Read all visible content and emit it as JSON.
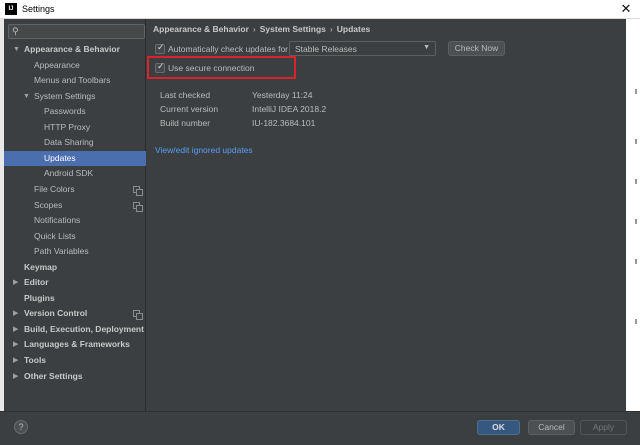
{
  "window": {
    "title": "Settings",
    "app_icon": "IJ"
  },
  "search": {
    "placeholder": ""
  },
  "tree": [
    {
      "label": "Appearance & Behavior",
      "level": 0,
      "bold": true,
      "arrow": "▼"
    },
    {
      "label": "Appearance",
      "level": 1
    },
    {
      "label": "Menus and Toolbars",
      "level": 1
    },
    {
      "label": "System Settings",
      "level": 1,
      "arrow": "▼"
    },
    {
      "label": "Passwords",
      "level": 2
    },
    {
      "label": "HTTP Proxy",
      "level": 2
    },
    {
      "label": "Data Sharing",
      "level": 2
    },
    {
      "label": "Updates",
      "level": 2,
      "selected": true
    },
    {
      "label": "Android SDK",
      "level": 2
    },
    {
      "label": "File Colors",
      "level": 1,
      "copy": true
    },
    {
      "label": "Scopes",
      "level": 1,
      "copy": true
    },
    {
      "label": "Notifications",
      "level": 1
    },
    {
      "label": "Quick Lists",
      "level": 1
    },
    {
      "label": "Path Variables",
      "level": 1
    },
    {
      "label": "Keymap",
      "level": 0,
      "bold": true
    },
    {
      "label": "Editor",
      "level": 0,
      "bold": true,
      "arrow": "▶"
    },
    {
      "label": "Plugins",
      "level": 0,
      "bold": true
    },
    {
      "label": "Version Control",
      "level": 0,
      "bold": true,
      "arrow": "▶",
      "copy": true
    },
    {
      "label": "Build, Execution, Deployment",
      "level": 0,
      "bold": true,
      "arrow": "▶"
    },
    {
      "label": "Languages & Frameworks",
      "level": 0,
      "bold": true,
      "arrow": "▶"
    },
    {
      "label": "Tools",
      "level": 0,
      "bold": true,
      "arrow": "▶"
    },
    {
      "label": "Other Settings",
      "level": 0,
      "bold": true,
      "arrow": "▶"
    }
  ],
  "breadcrumb": {
    "part1": "Appearance & Behavior",
    "sep": "›",
    "part2": "System Settings",
    "part3": "Updates"
  },
  "updates": {
    "auto_check_label": "Automatically check updates for",
    "auto_check_checked": true,
    "channel": "Stable Releases",
    "check_now_label": "Check Now",
    "secure_label": "Use secure connection",
    "secure_checked": true,
    "last_checked_label": "Last checked",
    "last_checked_value": "Yesterday 11:24",
    "current_version_label": "Current version",
    "current_version_value": "IntelliJ IDEA 2018.2",
    "build_number_label": "Build number",
    "build_number_value": "IU-182.3684.101",
    "ignored_link": "View/edit ignored updates"
  },
  "buttons": {
    "ok": "OK",
    "cancel": "Cancel",
    "apply": "Apply",
    "help": "?"
  },
  "colors": {
    "selection": "#4b6eaf",
    "highlight": "#d9232b",
    "link": "#589df6"
  }
}
